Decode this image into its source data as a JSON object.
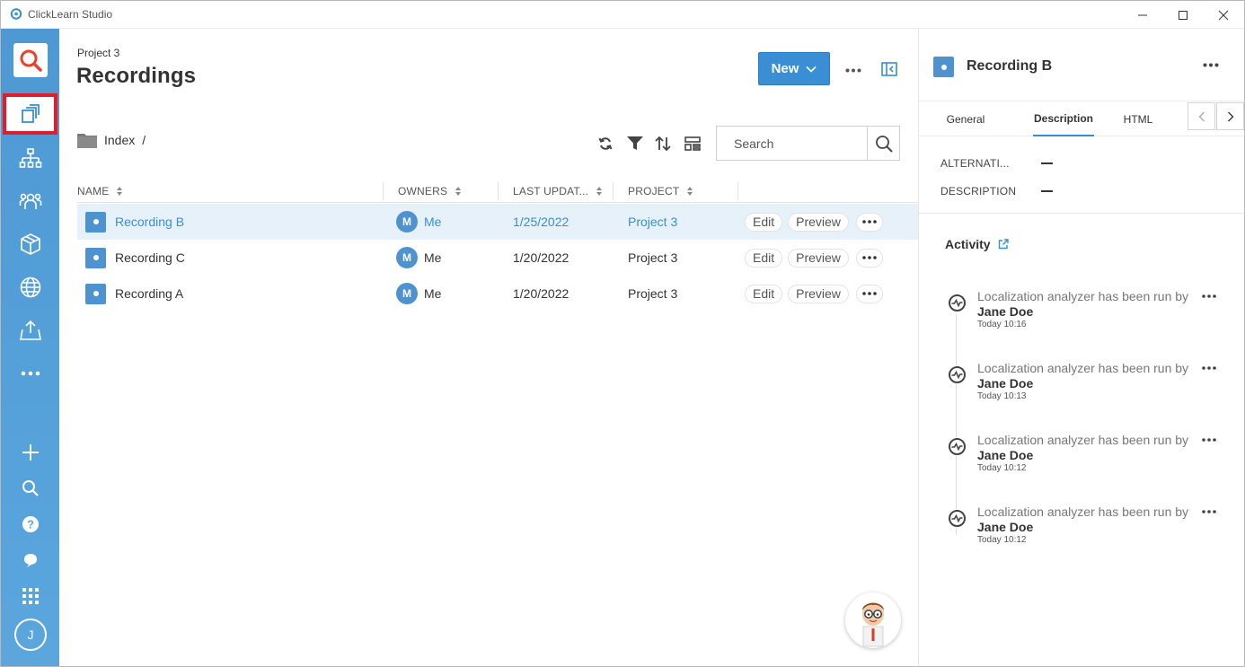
{
  "window": {
    "title": "ClickLearn Studio"
  },
  "rail": {
    "user_initial": "J"
  },
  "main": {
    "project": "Project 3",
    "title": "Recordings",
    "new_label": "New",
    "folder": "Index",
    "folder_sep": "/",
    "search_placeholder": "Search",
    "columns": {
      "name": "NAME",
      "owners": "OWNERS",
      "last_updated": "LAST UPDAT...",
      "project": "PROJECT"
    },
    "rows": [
      {
        "name": "Recording B",
        "owner_initial": "M",
        "owner": "Me",
        "date": "1/25/2022",
        "project": "Project 3",
        "edit": "Edit",
        "preview": "Preview"
      },
      {
        "name": "Recording C",
        "owner_initial": "M",
        "owner": "Me",
        "date": "1/20/2022",
        "project": "Project 3",
        "edit": "Edit",
        "preview": "Preview"
      },
      {
        "name": "Recording A",
        "owner_initial": "M",
        "owner": "Me",
        "date": "1/20/2022",
        "project": "Project 3",
        "edit": "Edit",
        "preview": "Preview"
      }
    ]
  },
  "panel": {
    "title": "Recording B",
    "tabs": [
      "General",
      "Description",
      "HTML"
    ],
    "active_tab": "Description",
    "props": {
      "alternative_label": "ALTERNATI...",
      "description_label": "DESCRIPTION"
    },
    "activity_title": "Activity",
    "activities": [
      {
        "text": "Localization analyzer has been run by",
        "user": "Jane Doe",
        "time": "Today 10:16"
      },
      {
        "text": "Localization analyzer has been run by",
        "user": "Jane Doe",
        "time": "Today 10:13"
      },
      {
        "text": "Localization analyzer has been run by",
        "user": "Jane Doe",
        "time": "Today 10:12"
      },
      {
        "text": "Localization analyzer has been run by",
        "user": "Jane Doe",
        "time": "Today 10:12"
      }
    ]
  },
  "colors": {
    "accent": "#3a8ed4",
    "rail": "#5aa6dd",
    "highlight": "#e21d2b",
    "selected_row": "#e6f1fa"
  }
}
